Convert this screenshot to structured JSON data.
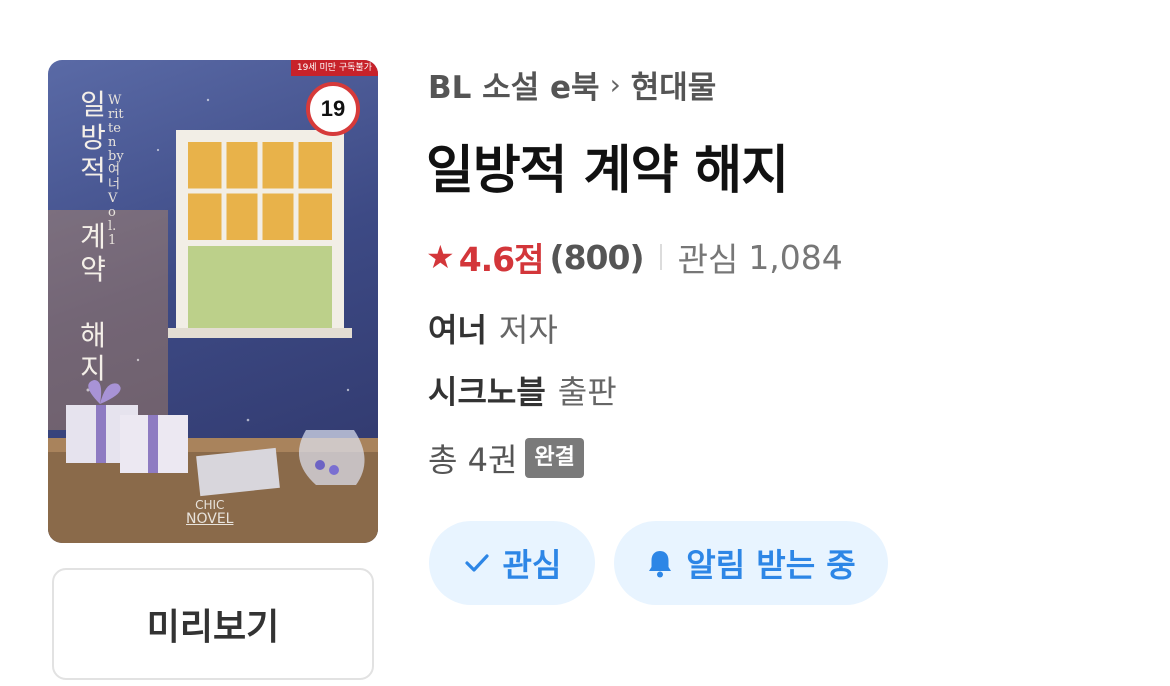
{
  "cover": {
    "age_strip": "19세 미만 구독불가",
    "age_badge": "19",
    "title_vertical": "일\n방\n적\n \n계\n약\n \n해\n지",
    "byline_vertical": "Written by 여너 Vol.1",
    "logo_line1": "CHIC",
    "logo_line2": "NOVEL"
  },
  "preview_button": {
    "label": "미리보기"
  },
  "breadcrumb": {
    "category": "BL 소설 e북",
    "separator": "›",
    "subcategory": "현대물"
  },
  "book": {
    "title": "일방적 계약 해지",
    "rating": {
      "star_icon": "★",
      "score": "4.6점",
      "count": "(800)"
    },
    "interest": {
      "label": "관심",
      "count": "1,084"
    },
    "author": {
      "name": "여너",
      "role": "저자"
    },
    "publisher": {
      "name": "시크노블",
      "role": "출판"
    },
    "volumes": {
      "text": "총 4권",
      "status": "완결"
    }
  },
  "actions": {
    "interest_button": {
      "label": "관심",
      "icon": "check-icon"
    },
    "notification_button": {
      "label": "알림 받는 중",
      "icon": "bell-icon"
    }
  },
  "colors": {
    "accent_red": "#d3363a",
    "action_blue": "#2d86e6",
    "action_bg": "#e8f4ff",
    "badge_gray": "#7a7a7a"
  }
}
